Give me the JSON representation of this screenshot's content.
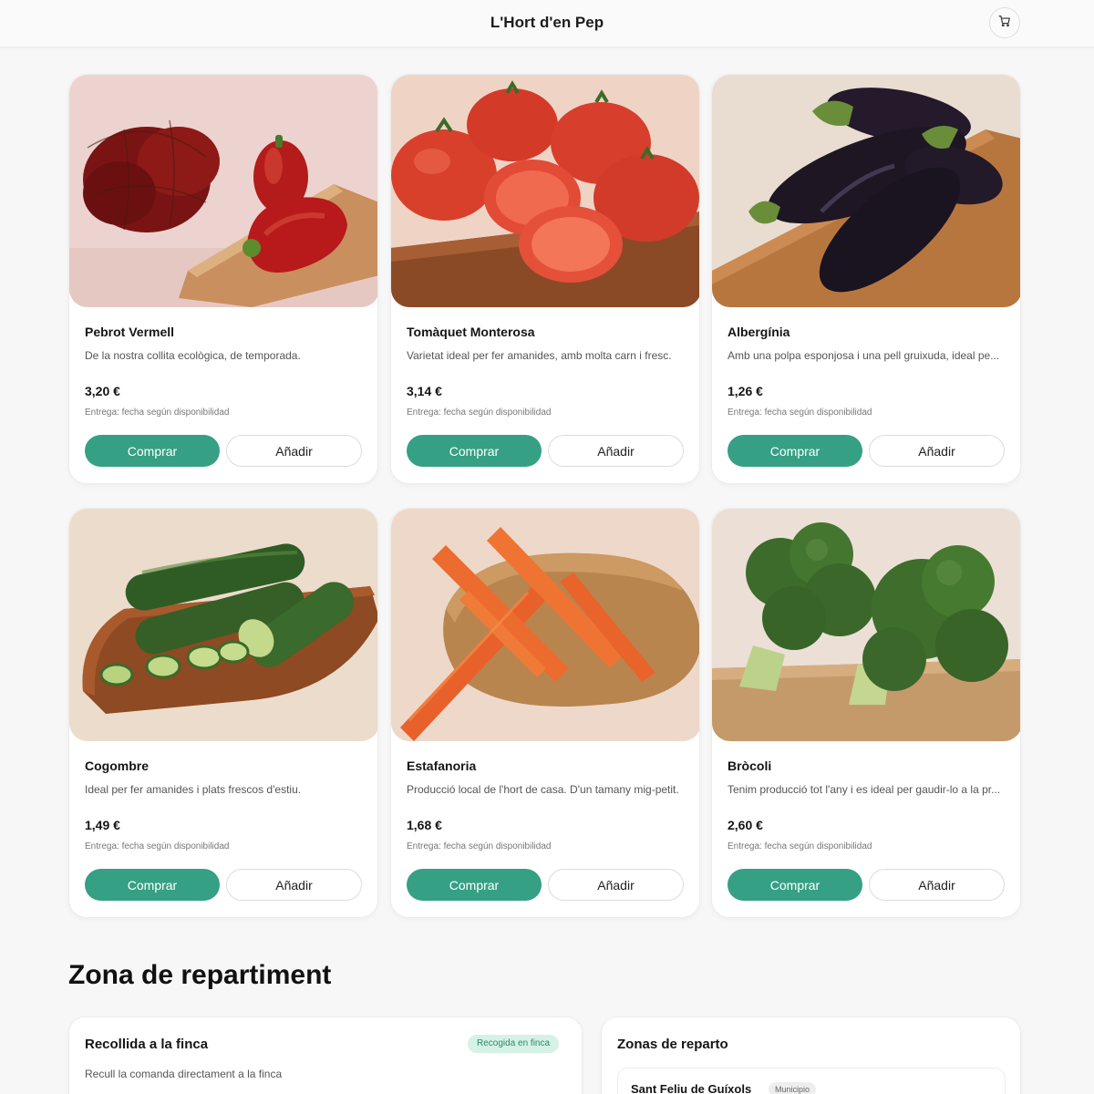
{
  "header": {
    "title": "L'Hort d'en Pep",
    "cart_icon": "cart-icon"
  },
  "products": [
    {
      "name": "Pebrot Vermell",
      "description": "De la nostra collita ecològica, de temporada.",
      "price": "3,20 €",
      "delivery": "Entrega: fecha según disponibilidad",
      "buy_label": "Comprar",
      "add_label": "Añadir"
    },
    {
      "name": "Tomàquet Monterosa",
      "description": "Varietat ideal per fer amanides, amb molta carn i fresc.",
      "price": "3,14 €",
      "delivery": "Entrega: fecha según disponibilidad",
      "buy_label": "Comprar",
      "add_label": "Añadir"
    },
    {
      "name": "Albergínia",
      "description": "Amb una polpa esponjosa i una pell gruixuda, ideal pe...",
      "price": "1,26 €",
      "delivery": "Entrega: fecha según disponibilidad",
      "buy_label": "Comprar",
      "add_label": "Añadir"
    },
    {
      "name": "Cogombre",
      "description": "Ideal per fer amanides i plats frescos d'estiu.",
      "price": "1,49 €",
      "delivery": "Entrega: fecha según disponibilidad",
      "buy_label": "Comprar",
      "add_label": "Añadir"
    },
    {
      "name": "Estafanoria",
      "description": "Producció local de l'hort de casa. D'un tamany mig-petit.",
      "price": "1,68 €",
      "delivery": "Entrega: fecha según disponibilidad",
      "buy_label": "Comprar",
      "add_label": "Añadir"
    },
    {
      "name": "Bròcoli",
      "description": "Tenim producció tot l'any i es ideal per gaudir-lo a la pr...",
      "price": "2,60 €",
      "delivery": "Entrega: fecha según disponibilidad",
      "buy_label": "Comprar",
      "add_label": "Añadir"
    }
  ],
  "delivery_zone": {
    "title": "Zona de repartiment",
    "pickup": {
      "title": "Recollida a la finca",
      "badge": "Recogida en finca",
      "description": "Recull la comanda directament a la finca"
    },
    "zones": {
      "title": "Zonas de reparto",
      "municipality": "Sant Feliu de Guíxols",
      "tag": "Municipio"
    }
  },
  "colors": {
    "accent": "#35a084",
    "badge_bg": "#d6f2e7",
    "page_bg": "#f7f7f7"
  }
}
